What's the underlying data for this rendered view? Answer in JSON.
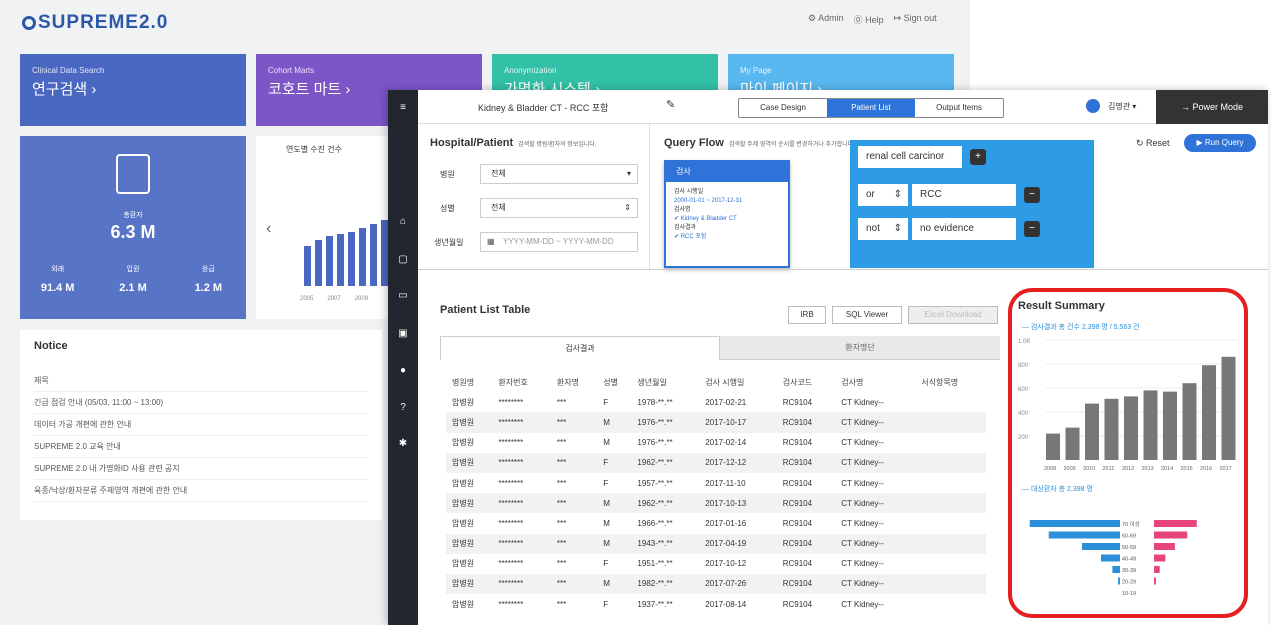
{
  "portal": {
    "logo": "SUPREME2.0",
    "links": [
      "⚙ Admin",
      "⓪ Help",
      "↦ Sign out"
    ],
    "cards": [
      {
        "sub": "Clinical Data Search",
        "main": "연구검색 ›",
        "color": "#4a67c2"
      },
      {
        "sub": "Cohort Marts",
        "main": "코호트 마트 ›",
        "color": "#7c55c7"
      },
      {
        "sub": "Anonymization",
        "main": "가명화 시스템 ›",
        "color": "#32c1a6"
      },
      {
        "sub": "My Page",
        "main": "마이 페이지 ›",
        "color": "#58b7ee"
      }
    ],
    "stat": {
      "label": "총환자",
      "value": "6.3 M",
      "items": [
        {
          "l": "외래",
          "v": "91.4 M"
        },
        {
          "l": "입원",
          "v": "2.1 M"
        },
        {
          "l": "응급",
          "v": "1.2 M"
        }
      ]
    },
    "mini_chart_title": "연도별 수진 건수",
    "mini_chart_years": [
      "2005",
      "2007",
      "2009"
    ],
    "notice": {
      "title": "Notice",
      "head": "제목",
      "items": [
        "긴급 점검 안내 (05/03, 11:00 ~ 13:00)",
        "데이터 가공 개편에 관한 안내",
        "SUPREME 2.0 교육 안내",
        "SUPREME 2.0 내 가명화ID 사용 관련 공지",
        "육종/낙상/환자분류 주제영역 개편에 관한 안내"
      ]
    }
  },
  "app": {
    "title": "Kidney & Bladder CT - RCC 포함",
    "tabs": [
      "Case Design",
      "Patient List",
      "Output Items"
    ],
    "user": "김명관 ▾",
    "power_mode": "→ Power Mode",
    "hospital": {
      "title": "Hospital/Patient",
      "hint": "검색할 병원/환자의 정보입니다.",
      "rows": [
        {
          "label": "병원",
          "value": "전체"
        },
        {
          "label": "성별",
          "value": "전체"
        },
        {
          "label": "생년월일",
          "value": "YYYY-MM-DD ~ YYYY-MM-DD"
        }
      ]
    },
    "query": {
      "title": "Query Flow",
      "hint": "검색할 주제 영역의 순서를 변경하거나 추가합니다. 조회를 원하는 주제 영역에서 조건을 설정하세요.",
      "reset": "↻ Reset",
      "run": "▶ Run Query",
      "node_title": "검사",
      "node_lines": [
        "검사 시행일",
        "2000-01-01 ~ 2017-12-31",
        "검사명",
        "✔ Kidney & Bladder CT",
        "검사결과",
        "✔ RCC 포함"
      ],
      "cond": [
        {
          "op": "",
          "val": "renal cell carcinor"
        },
        {
          "op": "or",
          "val": "RCC"
        },
        {
          "op": "not",
          "val": "no evidence"
        }
      ]
    },
    "list": {
      "title": "Patient List Table",
      "btn_irb": "IRB",
      "btn_sql": "SQL Viewer",
      "btn_dl": "Excel Download",
      "tabs": [
        "검사결과",
        "환자명단"
      ],
      "columns": [
        "병원명",
        "환자번호",
        "환자명",
        "성별",
        "생년월일",
        "검사 시행일",
        "검사코드",
        "검사명",
        "서식항목명"
      ],
      "rows": [
        [
          "암병원",
          "********",
          "***",
          "F",
          "1978-**.**",
          "2017-02-21",
          "RC9104",
          "CT Kidney--"
        ],
        [
          "암병원",
          "********",
          "***",
          "M",
          "1976-**.**",
          "2017-10-17",
          "RC9104",
          "CT Kidney--"
        ],
        [
          "암병원",
          "********",
          "***",
          "M",
          "1976-**.**",
          "2017-02-14",
          "RC9104",
          "CT Kidney--"
        ],
        [
          "암병원",
          "********",
          "***",
          "F",
          "1962-**.**",
          "2017-12-12",
          "RC9104",
          "CT Kidney--"
        ],
        [
          "암병원",
          "********",
          "***",
          "F",
          "1957-**.**",
          "2017-11-10",
          "RC9104",
          "CT Kidney--"
        ],
        [
          "암병원",
          "********",
          "***",
          "M",
          "1962-**.**",
          "2017-10-13",
          "RC9104",
          "CT Kidney--"
        ],
        [
          "암병원",
          "********",
          "***",
          "M",
          "1966-**.**",
          "2017-01-16",
          "RC9104",
          "CT Kidney--"
        ],
        [
          "암병원",
          "********",
          "***",
          "M",
          "1943-**.**",
          "2017-04-19",
          "RC9104",
          "CT Kidney--"
        ],
        [
          "암병원",
          "********",
          "***",
          "F",
          "1951-**.**",
          "2017-10-12",
          "RC9104",
          "CT Kidney--"
        ],
        [
          "암병원",
          "********",
          "***",
          "M",
          "1982-**.**",
          "2017-07-26",
          "RC9104",
          "CT Kidney--"
        ],
        [
          "암병원",
          "********",
          "***",
          "F",
          "1937-**.**",
          "2017-08-14",
          "RC9104",
          "CT Kidney--"
        ]
      ]
    },
    "summary": {
      "title": "Result Summary",
      "line1": "— 검사결과 총 건수 2,398 명 / 5,563 건",
      "line2": "— 대상환자 총 2,398 명",
      "y_ticks": [
        "1.0K",
        "800",
        "600",
        "400",
        "200"
      ],
      "years": [
        "2008",
        "2009",
        "2010",
        "2011",
        "2012",
        "2013",
        "2014",
        "2015",
        "2016",
        "2017"
      ],
      "counts": [
        220,
        270,
        470,
        510,
        530,
        580,
        570,
        640,
        790,
        860
      ],
      "ages": [
        "70 이상",
        "60-69",
        "50-59",
        "40-49",
        "30-39",
        "20-29",
        "10-19"
      ],
      "male": [
        95,
        75,
        40,
        20,
        8,
        2,
        0
      ],
      "female": [
        45,
        35,
        22,
        12,
        6,
        2,
        0
      ],
      "colors": {
        "bar": "#777777",
        "male": "#2b8fd9",
        "female": "#e7457a"
      }
    }
  }
}
